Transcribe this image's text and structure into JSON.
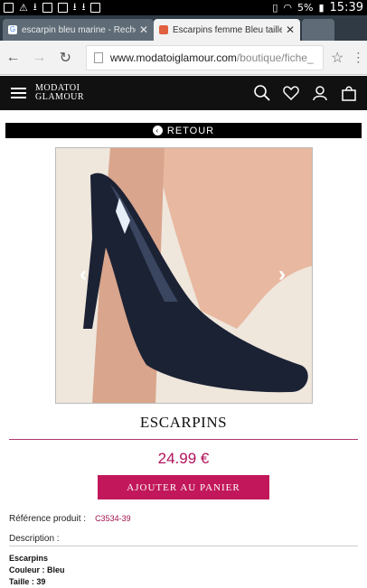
{
  "status_bar": {
    "time": "15:39",
    "battery": "5%"
  },
  "tabs": [
    {
      "title": "escarpin bleu marine - Reche",
      "close": "✕"
    },
    {
      "title": "Escarpins femme Bleu taille",
      "close": "✕"
    }
  ],
  "url": {
    "domain": "www.modatoiglamour.com",
    "path": "/boutique/fiche_"
  },
  "site": {
    "logo_line1": "MODATOI",
    "logo_line2": "GLAMOUR"
  },
  "back_label": "RETOUR",
  "product": {
    "title": "ESCARPINS",
    "price": "24.99 €",
    "add_to_cart": "AJOUTER AU PANIER",
    "reference_label": "Référence produit :",
    "reference_value": "C3534-39",
    "description_label": "Description :",
    "description_lines": [
      "Escarpins",
      "Couleur : Bleu",
      "Taille : 39"
    ]
  }
}
